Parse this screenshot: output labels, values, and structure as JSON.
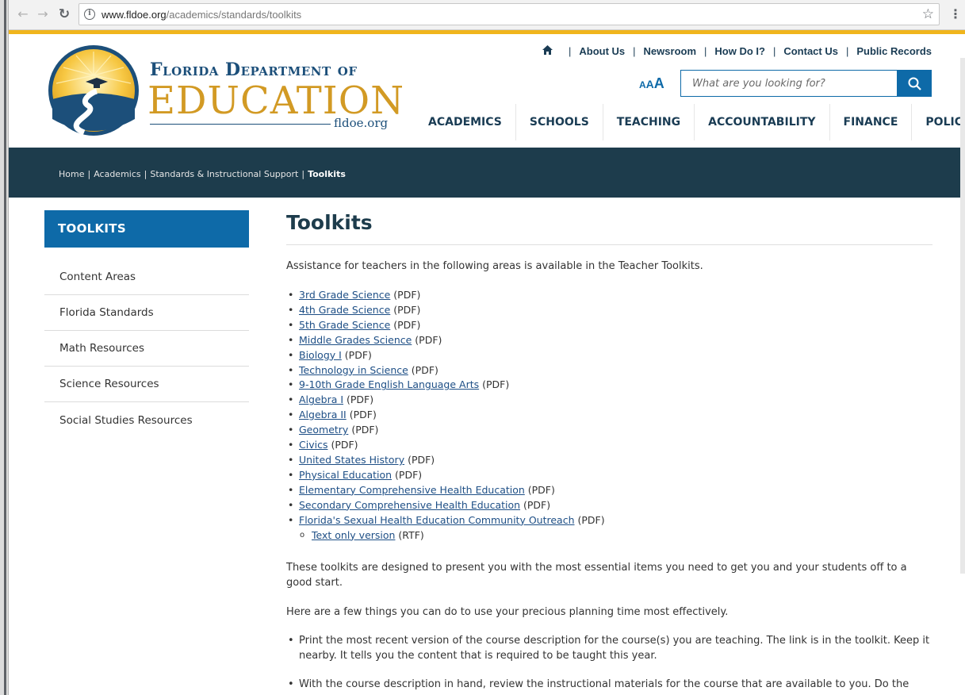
{
  "browser": {
    "url_host": "www.fldoe.org",
    "url_path": "/academics/standards/toolkits"
  },
  "header": {
    "logo_line1": "Florida Department of",
    "logo_line2": "EDUCATION",
    "logo_url": "fldoe.org",
    "utility_links": [
      "About Us",
      "Newsroom",
      "How Do I?",
      "Contact Us",
      "Public Records"
    ],
    "text_size_label": {
      "a1": "A",
      "a2": "A",
      "a3": "A"
    },
    "search_placeholder": "What are you looking for?",
    "nav": [
      "ACADEMICS",
      "SCHOOLS",
      "TEACHING",
      "ACCOUNTABILITY",
      "FINANCE",
      "POLICY"
    ]
  },
  "breadcrumb": {
    "items": [
      "Home",
      "Academics",
      "Standards & Instructional Support"
    ],
    "current": "Toolkits"
  },
  "sidebar": {
    "title": "TOOLKITS",
    "items": [
      "Content Areas",
      "Florida Standards",
      "Math Resources",
      "Science Resources",
      "Social Studies Resources"
    ]
  },
  "main": {
    "title": "Toolkits",
    "intro": "Assistance for teachers in the following areas is available in the Teacher Toolkits.",
    "toolkits": [
      {
        "label": "3rd Grade Science",
        "suffix": " (PDF)"
      },
      {
        "label": "4th Grade Science",
        "suffix": " (PDF)"
      },
      {
        "label": "5th Grade Science",
        "suffix": " (PDF)"
      },
      {
        "label": "Middle Grades Science",
        "suffix": " (PDF)"
      },
      {
        "label": "Biology I",
        "suffix": " (PDF)"
      },
      {
        "label": "Technology in Science",
        "suffix": " (PDF)"
      },
      {
        "label": "9-10th Grade English Language Arts",
        "suffix": " (PDF)"
      },
      {
        "label": "Algebra I",
        "suffix": " (PDF)"
      },
      {
        "label": "Algebra II",
        "suffix": " (PDF)"
      },
      {
        "label": "Geometry",
        "suffix": " (PDF)"
      },
      {
        "label": "Civics",
        "suffix": " (PDF)"
      },
      {
        "label": "United States History",
        "suffix": " (PDF)"
      },
      {
        "label": "Physical Education",
        "suffix": " (PDF)"
      },
      {
        "label": "Elementary Comprehensive Health Education",
        "suffix": " (PDF)"
      },
      {
        "label": "Secondary Comprehensive Health Education",
        "suffix": " (PDF)"
      },
      {
        "label": "Florida's Sexual Health Education Community Outreach",
        "suffix": " (PDF)"
      }
    ],
    "sub_item": {
      "label": "Text only version",
      "suffix": " (RTF)"
    },
    "paragraph1": "These toolkits are designed to present you with the most essential items you need to get you and your students off to a good start.",
    "paragraph2": "Here are a few things you can do to use your precious planning time most effectively.",
    "tips": [
      "Print the most recent version of the course description for the course(s) you are teaching. The link is in the toolkit. Keep it nearby. It tells you the content that is required to be taught this year.",
      "With the course description in hand, review the instructional materials for the course that are available to you. Do the"
    ]
  },
  "colors": {
    "brand_blue": "#0e6aa8",
    "navy": "#1d3c4c",
    "gold": "#f0b51c"
  }
}
